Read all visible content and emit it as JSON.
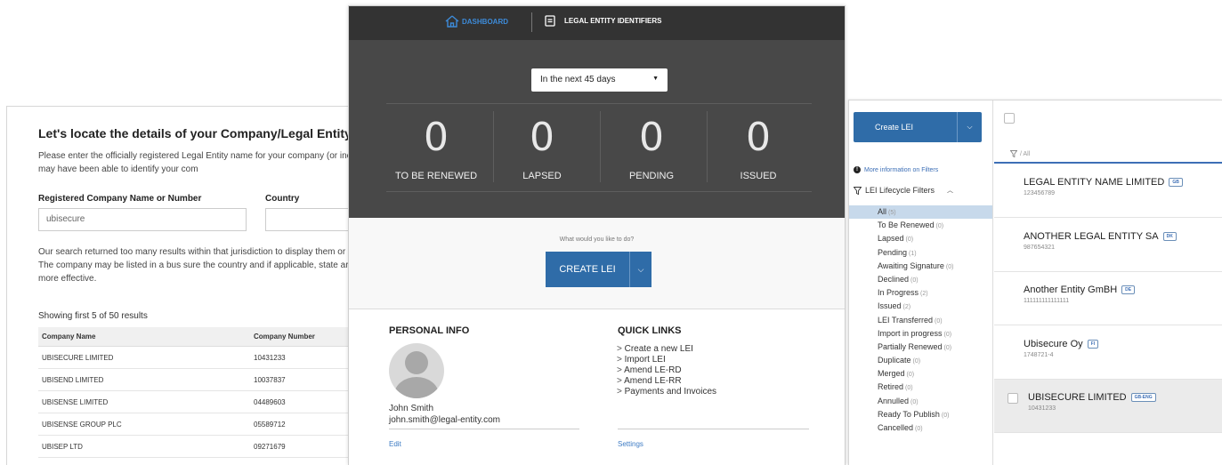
{
  "left": {
    "title": "Let's locate the details of your Company/Legal Entity...",
    "intro": "Please enter the officially registered Legal Entity name for your company (or incorporation. (Please note that we may have been able to identify your com",
    "name_label": "Registered Company Name or Number",
    "country_label": "Country",
    "name_value": "ubisecure",
    "message": "Our search returned too many results within that jurisdiction to display them or search with less letters or words. e.g. The company may be listed in a bus sure the country and if applicable, state are selected. Alternatively, if you kno more effective.",
    "results_count": "Showing first 5 of 50 results",
    "columns": [
      "Company Name",
      "Company Number"
    ],
    "rows": [
      {
        "name": "UBISECURE LIMITED",
        "number": "10431233"
      },
      {
        "name": "UBISEND LIMITED",
        "number": "10037837"
      },
      {
        "name": "UBISENSE LIMITED",
        "number": "04489603"
      },
      {
        "name": "UBISENSE GROUP PLC",
        "number": "05589712"
      },
      {
        "name": "UBISEP LTD",
        "number": "09271679"
      }
    ]
  },
  "center": {
    "nav_dashboard": "DASHBOARD",
    "nav_lei": "LEGAL ENTITY IDENTIFIERS",
    "period": "In the next 45 days",
    "stats": [
      {
        "value": "0",
        "label": "TO BE RENEWED"
      },
      {
        "value": "0",
        "label": "LAPSED"
      },
      {
        "value": "0",
        "label": "PENDING"
      },
      {
        "value": "0",
        "label": "ISSUED"
      }
    ],
    "ask": "What would you like to do?",
    "create_label": "CREATE LEI",
    "personal_title": "PERSONAL INFO",
    "user_name": "John Smith",
    "user_email": "john.smith@legal-entity.com",
    "edit_label": "Edit",
    "quick_title": "QUICK LINKS",
    "quick_links": [
      "Create a new LEI",
      "Import LEI",
      "Amend LE-RD",
      "Amend LE-RR",
      "Payments and Invoices"
    ],
    "settings_label": "Settings"
  },
  "right": {
    "create_label": "Create LEI",
    "more_info": "More information on Filters",
    "lifecycle_label": "LEI Lifecycle Filters",
    "all_filter_label": "/ All",
    "filters": [
      {
        "label": "All",
        "count": "(5)"
      },
      {
        "label": "To Be Renewed",
        "count": "(0)"
      },
      {
        "label": "Lapsed",
        "count": "(0)"
      },
      {
        "label": "Pending",
        "count": "(1)"
      },
      {
        "label": "Awaiting Signature",
        "count": "(0)"
      },
      {
        "label": "Declined",
        "count": "(0)"
      },
      {
        "label": "In Progress",
        "count": "(2)"
      },
      {
        "label": "Issued",
        "count": "(2)"
      },
      {
        "label": "LEI Transferred",
        "count": "(0)"
      },
      {
        "label": "Import in progress",
        "count": "(0)"
      },
      {
        "label": "Partially Renewed",
        "count": "(0)"
      },
      {
        "label": "Duplicate",
        "count": "(0)"
      },
      {
        "label": "Merged",
        "count": "(0)"
      },
      {
        "label": "Retired",
        "count": "(0)"
      },
      {
        "label": "Annulled",
        "count": "(0)"
      },
      {
        "label": "Ready To Publish",
        "count": "(0)"
      },
      {
        "label": "Cancelled",
        "count": "(0)"
      }
    ],
    "entities": [
      {
        "name": "LEGAL ENTITY NAME LIMITED",
        "badge": "GB",
        "id": "123456789"
      },
      {
        "name": "ANOTHER LEGAL ENTITY SA",
        "badge": "DK",
        "id": "987654321"
      },
      {
        "name": "Another Entity GmBH",
        "badge": "DE",
        "id": "111111111111111"
      },
      {
        "name": "Ubisecure Oy",
        "badge": "FI",
        "id": "1748721-4"
      },
      {
        "name": "UBISECURE LIMITED",
        "badge": "GB-ENG",
        "id": "10431233"
      }
    ]
  }
}
